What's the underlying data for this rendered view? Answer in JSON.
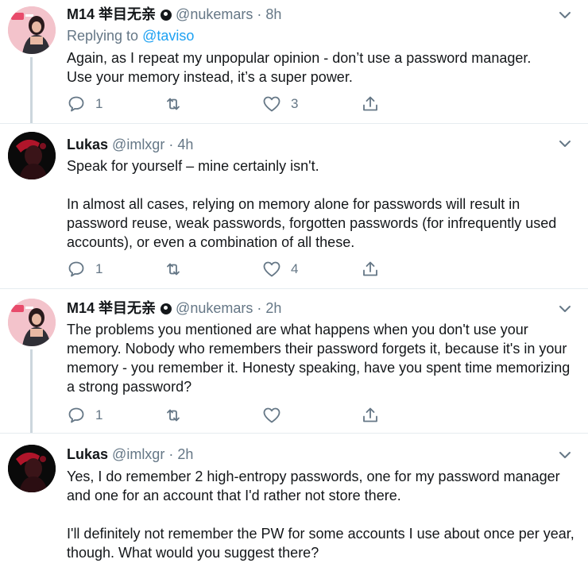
{
  "tweets": [
    {
      "display_name": "M14 举目无亲",
      "handle": "@nukemars",
      "separator": "·",
      "time": "8h",
      "replying_to_prefix": "Replying to ",
      "replying_to_handle": "@taviso",
      "paragraphs": [
        "Again, as I repeat my unpopular opinion - don’t use a password manager.",
        "Use your memory instead, it’s a super power."
      ],
      "reply_count": "1",
      "retweet_count": "",
      "like_count": "3"
    },
    {
      "display_name": "Lukas",
      "handle": "@imlxgr",
      "separator": "·",
      "time": "4h",
      "paragraphs": [
        "Speak for yourself – mine certainly isn't.",
        "In almost all cases, relying on memory alone for passwords will result in password reuse, weak passwords, forgotten passwords (for infrequently used accounts), or even a combination of all these."
      ],
      "reply_count": "1",
      "retweet_count": "",
      "like_count": "4"
    },
    {
      "display_name": "M14 举目无亲",
      "handle": "@nukemars",
      "separator": "·",
      "time": "2h",
      "paragraphs": [
        "The problems you mentioned are what happens when you don't use your memory. Nobody who remembers their password forgets it, because it's in your memory - you remember it. Honesty speaking, have you spent time memorizing a strong password?"
      ],
      "reply_count": "1",
      "retweet_count": "",
      "like_count": ""
    },
    {
      "display_name": "Lukas",
      "handle": "@imlxgr",
      "separator": "·",
      "time": "2h",
      "paragraphs": [
        "Yes, I do remember 2 high-entropy passwords, one for my password manager and one for an account that I'd rather not store there.",
        "I'll definitely not remember the PW for some accounts I use about once per year, though. What would you suggest there?"
      ]
    }
  ],
  "icons": {
    "reply": "reply-icon",
    "retweet": "retweet-icon",
    "like": "heart-icon",
    "share": "share-icon",
    "more": "chevron-down-icon",
    "verified_badge": "dot-badge-icon"
  },
  "colors": {
    "text": "#14171a",
    "secondary": "#657786",
    "link": "#1da1f2",
    "thread_line": "#ccd6dd",
    "divider": "#e6ecf0"
  }
}
